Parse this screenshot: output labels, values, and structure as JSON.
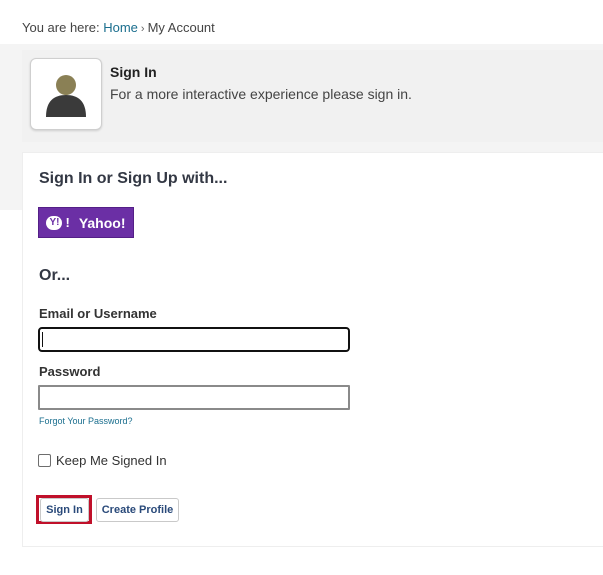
{
  "breadcrumb": {
    "prefix": "You are here:",
    "home": "Home",
    "separator": "›",
    "current": "My Account"
  },
  "banner": {
    "title": "Sign In",
    "subtitle": "For a more interactive experience please sign in.",
    "avatar_icon": "user-silhouette-icon"
  },
  "card": {
    "heading": "Sign In or Sign Up with...",
    "yahoo_label": "Yahoo!",
    "yahoo_icon_text": "Y!",
    "yahoo_color": "#6b2fa5",
    "or_text": "Or...",
    "email_label": "Email or Username",
    "email_value": "",
    "password_label": "Password",
    "password_value": "",
    "forgot_label": "Forgot Your Password?",
    "keep_signed_label": "Keep Me Signed In",
    "keep_signed_checked": false,
    "signin_button": "Sign In",
    "create_button": "Create Profile",
    "focus_color": "#c0102a",
    "link_color": "#1a6e8e"
  }
}
